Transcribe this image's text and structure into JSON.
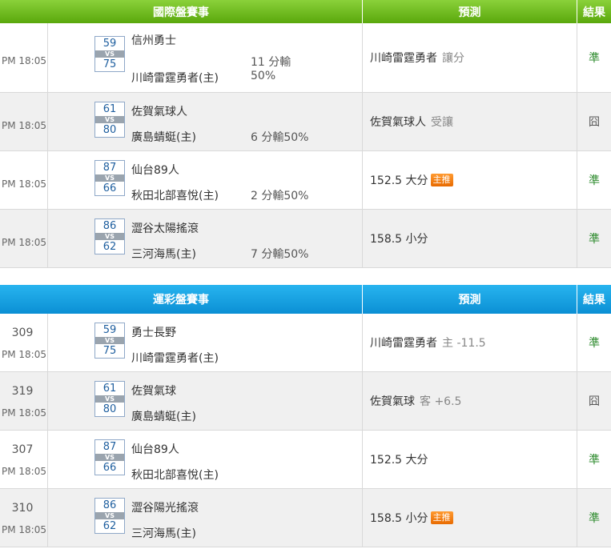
{
  "section1": {
    "header": {
      "game": "國際盤賽事",
      "pred": "預測",
      "res": "結果"
    },
    "rows": [
      {
        "time": "PM 18:05",
        "away_score": "59",
        "home_score": "75",
        "away": "信州勇士",
        "home": "川崎雷霆勇者(主)",
        "note_line1": "11 分輸",
        "note_line2": "50%",
        "pred": "川崎雷霆勇者",
        "pred_sub": "讓分",
        "badge": "",
        "result": "準",
        "result_type": "win"
      },
      {
        "time": "PM 18:05",
        "away_score": "61",
        "home_score": "80",
        "away": "佐賀氣球人",
        "home": "廣島蜻蜓(主)",
        "note": "6 分輸50%",
        "pred": "佐賀氣球人",
        "pred_sub": "受讓",
        "badge": "",
        "result": "囧",
        "result_type": "lose"
      },
      {
        "time": "PM 18:05",
        "away_score": "87",
        "home_score": "66",
        "away": "仙台89人",
        "home": "秋田北部喜悅(主)",
        "note": "2 分輸50%",
        "pred": "152.5 大分",
        "pred_sub": "",
        "badge": "主推",
        "result": "準",
        "result_type": "win"
      },
      {
        "time": "PM 18:05",
        "away_score": "86",
        "home_score": "62",
        "away": "澀谷太陽搖滾",
        "home": "三河海馬(主)",
        "note": "7 分輸50%",
        "pred": "158.5 小分",
        "pred_sub": "",
        "badge": "",
        "result": "準",
        "result_type": "win"
      }
    ]
  },
  "section2": {
    "header": {
      "game": "運彩盤賽事",
      "pred": "預測",
      "res": "結果"
    },
    "rows": [
      {
        "num": "309",
        "time": "PM 18:05",
        "away_score": "59",
        "home_score": "75",
        "away": "勇士長野",
        "home": "川崎雷霆勇者(主)",
        "pred": "川崎雷霆勇者",
        "pred_sub": "主 -11.5",
        "badge": "",
        "result": "準",
        "result_type": "win"
      },
      {
        "num": "319",
        "time": "PM 18:05",
        "away_score": "61",
        "home_score": "80",
        "away": "佐賀氣球",
        "home": "廣島蜻蜓(主)",
        "pred": "佐賀氣球",
        "pred_sub": "客 +6.5",
        "badge": "",
        "result": "囧",
        "result_type": "lose"
      },
      {
        "num": "307",
        "time": "PM 18:05",
        "away_score": "87",
        "home_score": "66",
        "away": "仙台89人",
        "home": "秋田北部喜悅(主)",
        "pred": "152.5 大分",
        "pred_sub": "",
        "badge": "",
        "result": "準",
        "result_type": "win"
      },
      {
        "num": "310",
        "time": "PM 18:05",
        "away_score": "86",
        "home_score": "62",
        "away": "澀谷陽光搖滾",
        "home": "三河海馬(主)",
        "pred": "158.5 小分",
        "pred_sub": "",
        "badge": "主推",
        "result": "準",
        "result_type": "win"
      }
    ]
  },
  "vs_label": "VS",
  "colors": {
    "green_header": "#6cbd1c",
    "blue_header": "#1aa3e3",
    "win": "#2e8b2e",
    "badge": "#f08020"
  }
}
